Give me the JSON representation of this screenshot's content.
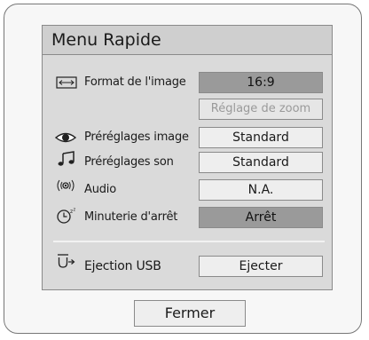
{
  "menu": {
    "title": "Menu Rapide",
    "rows": [
      {
        "icon": "aspect-ratio-icon",
        "label": "Format de l'image",
        "value": "16:9",
        "state": "active"
      },
      {
        "icon": "",
        "label": "",
        "value": "Réglage de zoom",
        "state": "disabled"
      },
      {
        "icon": "eye-icon",
        "label": "Préréglages image",
        "value": "Standard",
        "state": "normal"
      },
      {
        "icon": "music-note-icon",
        "label": "Préréglages son",
        "value": "Standard",
        "state": "normal"
      },
      {
        "icon": "audio-surround-icon",
        "label": "Audio",
        "value": "N.A.",
        "state": "normal"
      },
      {
        "icon": "sleep-timer-icon",
        "label": "Minuterie d'arrêt",
        "value": "Arrêt",
        "state": "active"
      },
      {
        "icon": "usb-eject-icon",
        "label": "Ejection USB",
        "value": "Ejecter",
        "state": "normal"
      }
    ],
    "close_label": "Fermer"
  },
  "colors": {
    "panel_bg": "#dadada",
    "header_bg": "#cfcfcf",
    "active_value_bg": "#9a9a9a",
    "normal_value_bg": "#eeeeee",
    "disabled_text": "#9a9a9a"
  }
}
